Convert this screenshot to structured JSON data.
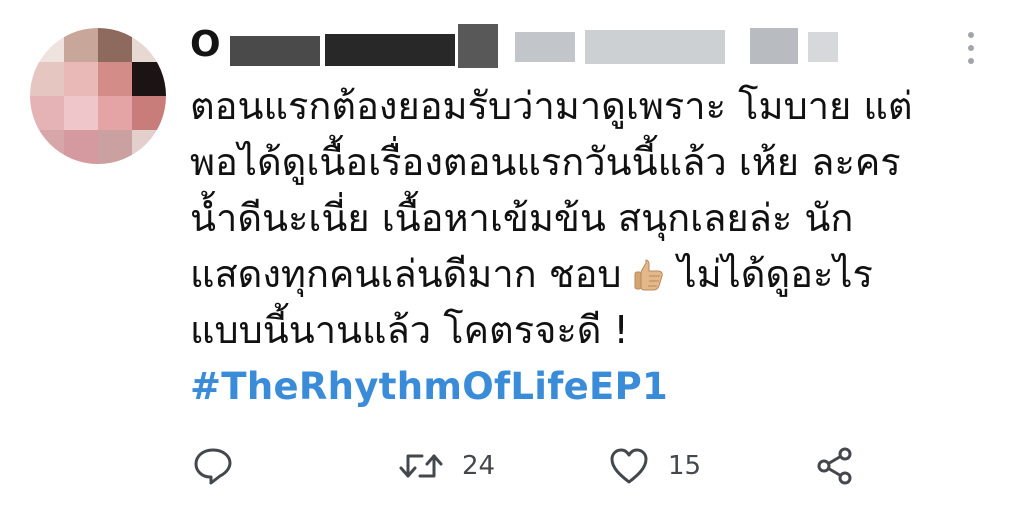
{
  "tweet": {
    "author_name": "O",
    "text_lines": [
      "ตอนแรกต้องยอมรับว่ามาดูเพราะ โมบาย แต่",
      "พอได้ดูเนื้อเรื่องตอนแรกวันนี้แล้ว เห้ย ละคร",
      "น้ำดีนะเนี่ย เนื้อหาเข้มข้น สนุกเลยล่ะ นัก",
      "แสดงทุกคนเล่นดีมาก ชอบ",
      "แบบนี้นานแล้ว โคตรจะดี !"
    ],
    "line4_tail": "ไม่ได้ดูอะไร",
    "hashtag": "#TheRhythmOfLifeEP1",
    "retweet_count": "24",
    "like_count": "15"
  },
  "icons": {
    "more": "more-vertical-icon",
    "reply": "reply-icon",
    "retweet": "retweet-icon",
    "like": "heart-icon",
    "share": "share-icon",
    "emoji": "thumbs-up-emoji"
  },
  "colors": {
    "hashtag": "#3a8cd8",
    "icon": "#44484c",
    "text": "#111111"
  }
}
